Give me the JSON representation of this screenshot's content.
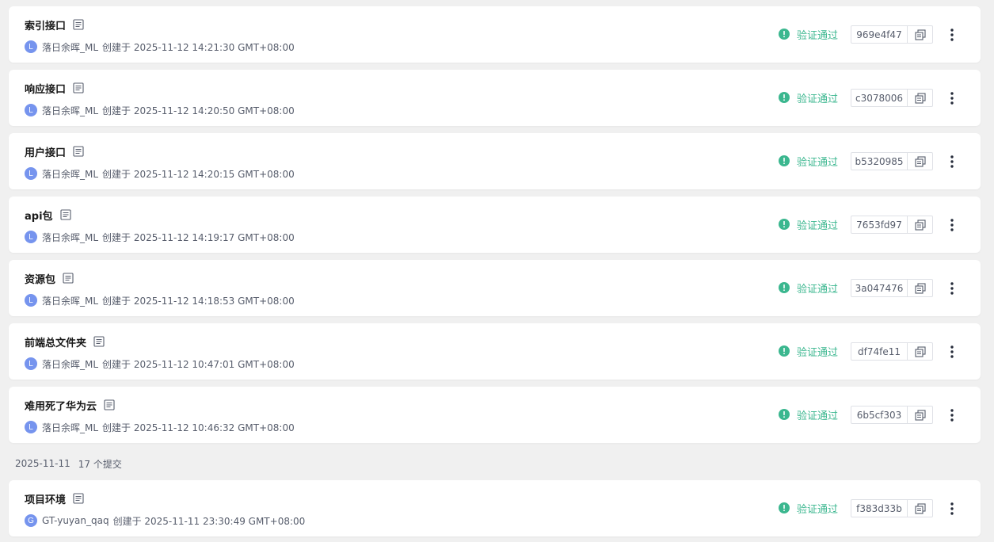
{
  "colors": {
    "background": "#f0f0f0",
    "card": "#ffffff",
    "success": "#3bb78f",
    "avatar": "#7694ee",
    "meta_text": "#575d6c"
  },
  "commits_top": [
    {
      "title": "索引接口",
      "avatar": "L",
      "author": "落日余晖_ML",
      "created": "创建于 2025-11-12 14:21:30 GMT+08:00",
      "status": "验证通过",
      "hash": "969e4f47"
    },
    {
      "title": "响应接口",
      "avatar": "L",
      "author": "落日余晖_ML",
      "created": "创建于 2025-11-12 14:20:50 GMT+08:00",
      "status": "验证通过",
      "hash": "c3078006"
    },
    {
      "title": "用户接口",
      "avatar": "L",
      "author": "落日余晖_ML",
      "created": "创建于 2025-11-12 14:20:15 GMT+08:00",
      "status": "验证通过",
      "hash": "b5320985"
    },
    {
      "title": "api包",
      "avatar": "L",
      "author": "落日余晖_ML",
      "created": "创建于 2025-11-12 14:19:17 GMT+08:00",
      "status": "验证通过",
      "hash": "7653fd97"
    },
    {
      "title": "资源包",
      "avatar": "L",
      "author": "落日余晖_ML",
      "created": "创建于 2025-11-12 14:18:53 GMT+08:00",
      "status": "验证通过",
      "hash": "3a047476"
    },
    {
      "title": "前端总文件夹",
      "avatar": "L",
      "author": "落日余晖_ML",
      "created": "创建于 2025-11-12 10:47:01 GMT+08:00",
      "status": "验证通过",
      "hash": "df74fe11"
    },
    {
      "title": "难用死了华为云",
      "avatar": "L",
      "author": "落日余晖_ML",
      "created": "创建于 2025-11-12 10:46:32 GMT+08:00",
      "status": "验证通过",
      "hash": "6b5cf303"
    }
  ],
  "group_header": {
    "date": "2025-11-11",
    "count": "17 个提交"
  },
  "commits_bottom": [
    {
      "title": "项目环境",
      "avatar": "G",
      "author": "GT-yuyan_qaq",
      "created": "创建于 2025-11-11 23:30:49 GMT+08:00",
      "status": "验证通过",
      "hash": "f383d33b"
    }
  ],
  "icons": {
    "doc": "document-icon",
    "status": "check-circle-icon",
    "copy": "copy-icon",
    "more": "more-vertical-icon"
  }
}
